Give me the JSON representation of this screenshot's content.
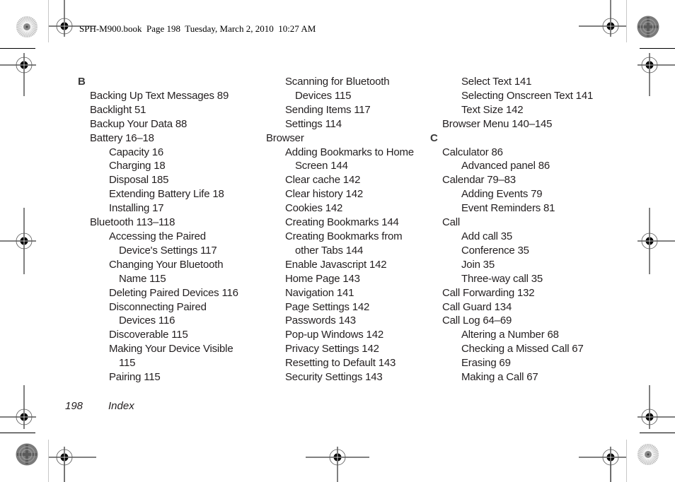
{
  "header": {
    "slug": "SPH-M900.book  Page 198  Tuesday, March 2, 2010  10:27 AM"
  },
  "index": {
    "columns": [
      {
        "entries": [
          {
            "text": "B",
            "level": "letter"
          },
          {
            "text": "Backing Up Text Messages 89",
            "level": "l1"
          },
          {
            "text": "Backlight 51",
            "level": "l1"
          },
          {
            "text": "Backup Your Data 88",
            "level": "l1"
          },
          {
            "text": "Battery 16–18",
            "level": "l1"
          },
          {
            "text": "Capacity 16",
            "level": "l2"
          },
          {
            "text": "Charging 18",
            "level": "l2"
          },
          {
            "text": "Disposal 185",
            "level": "l2"
          },
          {
            "text": "Extending Battery Life 18",
            "level": "l2"
          },
          {
            "text": "Installing 17",
            "level": "l2"
          },
          {
            "text": "Bluetooth 113–118",
            "level": "l1"
          },
          {
            "text": "Accessing the Paired",
            "level": "l2"
          },
          {
            "text": "Device's Settings 117",
            "level": "l2 cont"
          },
          {
            "text": "Changing Your Bluetooth",
            "level": "l2"
          },
          {
            "text": "Name 115",
            "level": "l2 cont"
          },
          {
            "text": "Deleting Paired Devices 116",
            "level": "l2"
          },
          {
            "text": "Disconnecting Paired",
            "level": "l2"
          },
          {
            "text": "Devices 116",
            "level": "l2 cont"
          },
          {
            "text": "Discoverable 115",
            "level": "l2"
          },
          {
            "text": "Making Your Device Visible",
            "level": "l2"
          },
          {
            "text": "115",
            "level": "l2 cont"
          },
          {
            "text": "Pairing 115",
            "level": "l2"
          }
        ]
      },
      {
        "entries": [
          {
            "text": "Scanning for Bluetooth",
            "level": "l2"
          },
          {
            "text": "Devices 115",
            "level": "l2 cont"
          },
          {
            "text": "Sending Items 117",
            "level": "l2"
          },
          {
            "text": "Settings 114",
            "level": "l2"
          },
          {
            "text": "Browser",
            "level": "l1"
          },
          {
            "text": "Adding Bookmarks to Home",
            "level": "l2"
          },
          {
            "text": "Screen 144",
            "level": "l2 cont"
          },
          {
            "text": "Clear cache 142",
            "level": "l2"
          },
          {
            "text": "Clear history 142",
            "level": "l2"
          },
          {
            "text": "Cookies 142",
            "level": "l2"
          },
          {
            "text": "Creating Bookmarks 144",
            "level": "l2"
          },
          {
            "text": "Creating Bookmarks from",
            "level": "l2"
          },
          {
            "text": "other Tabs 144",
            "level": "l2 cont"
          },
          {
            "text": "Enable Javascript 142",
            "level": "l2"
          },
          {
            "text": "Home Page 143",
            "level": "l2"
          },
          {
            "text": "Navigation 141",
            "level": "l2"
          },
          {
            "text": "Page Settings 142",
            "level": "l2"
          },
          {
            "text": "Passwords 143",
            "level": "l2"
          },
          {
            "text": "Pop-up Windows 142",
            "level": "l2"
          },
          {
            "text": "Privacy Settings 142",
            "level": "l2"
          },
          {
            "text": "Resetting to Default 143",
            "level": "l2"
          },
          {
            "text": "Security Settings 143",
            "level": "l2"
          }
        ]
      },
      {
        "entries": [
          {
            "text": "Select Text 141",
            "level": "l2"
          },
          {
            "text": "Selecting Onscreen Text 141",
            "level": "l2"
          },
          {
            "text": "Text Size 142",
            "level": "l2"
          },
          {
            "text": "Browser Menu 140–145",
            "level": "l1"
          },
          {
            "text": "C",
            "level": "letter"
          },
          {
            "text": "Calculator 86",
            "level": "l1"
          },
          {
            "text": "Advanced panel 86",
            "level": "l2"
          },
          {
            "text": "Calendar 79–83",
            "level": "l1"
          },
          {
            "text": "Adding Events 79",
            "level": "l2"
          },
          {
            "text": "Event Reminders 81",
            "level": "l2"
          },
          {
            "text": "Call",
            "level": "l1"
          },
          {
            "text": "Add call 35",
            "level": "l2"
          },
          {
            "text": "Conference 35",
            "level": "l2"
          },
          {
            "text": "Join 35",
            "level": "l2"
          },
          {
            "text": "Three-way call 35",
            "level": "l2"
          },
          {
            "text": "Call Forwarding 132",
            "level": "l1"
          },
          {
            "text": "Call Guard 134",
            "level": "l1"
          },
          {
            "text": "Call Log 64–69",
            "level": "l1"
          },
          {
            "text": "Altering a Number 68",
            "level": "l2"
          },
          {
            "text": "Checking a Missed Call 67",
            "level": "l2"
          },
          {
            "text": "Erasing 69",
            "level": "l2"
          },
          {
            "text": "Making a Call 67",
            "level": "l2"
          }
        ]
      }
    ]
  },
  "footer": {
    "page_number": "198",
    "section": "Index"
  },
  "marks": {
    "registration": [
      {
        "name": "registration-mark-top-left"
      },
      {
        "name": "registration-mark-top-right"
      },
      {
        "name": "registration-mark-upper-left"
      },
      {
        "name": "registration-mark-upper-right"
      },
      {
        "name": "registration-mark-mid-left"
      },
      {
        "name": "registration-mark-mid-right"
      },
      {
        "name": "registration-mark-lower-left"
      },
      {
        "name": "registration-mark-lower-right"
      },
      {
        "name": "registration-mark-bottom-left"
      },
      {
        "name": "registration-mark-bottom-center"
      },
      {
        "name": "registration-mark-bottom-right"
      }
    ]
  }
}
